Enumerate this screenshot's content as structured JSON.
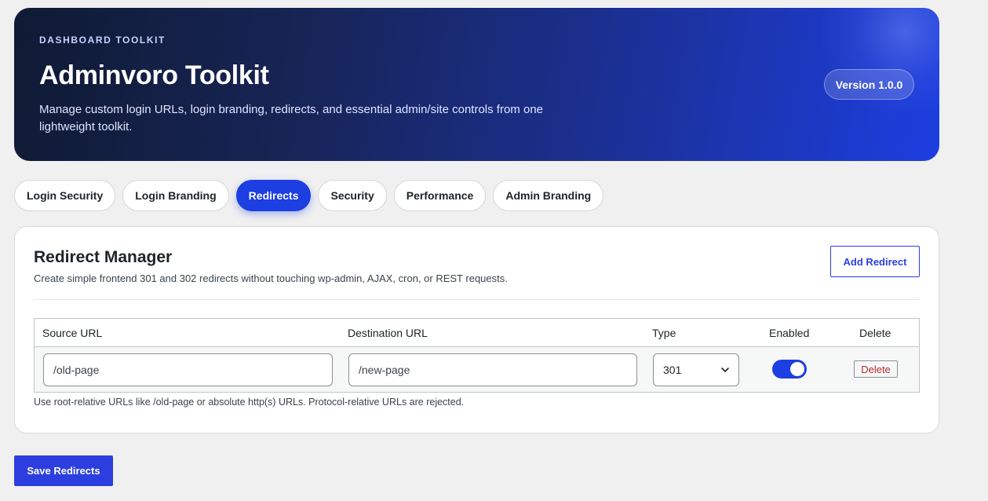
{
  "header": {
    "eyebrow": "DASHBOARD TOOLKIT",
    "title": "Adminvoro Toolkit",
    "description": "Manage custom login URLs, login branding, redirects, and essential admin/site controls from one lightweight toolkit.",
    "version": "Version 1.0.0"
  },
  "tabs": [
    {
      "label": "Login Security",
      "active": false
    },
    {
      "label": "Login Branding",
      "active": false
    },
    {
      "label": "Redirects",
      "active": true
    },
    {
      "label": "Security",
      "active": false
    },
    {
      "label": "Performance",
      "active": false
    },
    {
      "label": "Admin Branding",
      "active": false
    }
  ],
  "panel": {
    "title": "Redirect Manager",
    "subtitle": "Create simple frontend 301 and 302 redirects without touching wp-admin, AJAX, cron, or REST requests.",
    "add_button": "Add Redirect",
    "columns": [
      "Source URL",
      "Destination URL",
      "Type",
      "Enabled",
      "Delete"
    ],
    "rows": [
      {
        "source": "/old-page",
        "destination": "/new-page",
        "type": "301",
        "enabled": true,
        "delete_label": "Delete"
      }
    ],
    "hint": "Use root-relative URLs like /old-page or absolute http(s) URLs. Protocol-relative URLs are rejected."
  },
  "footer": {
    "save_button": "Save Redirects"
  },
  "colors": {
    "accent": "#1d3ee0",
    "button": "#2c3ee0",
    "danger": "#b32d2e",
    "background": "#f0f0f1"
  },
  "icons": {
    "select_arrow": "chevron-down-icon"
  }
}
